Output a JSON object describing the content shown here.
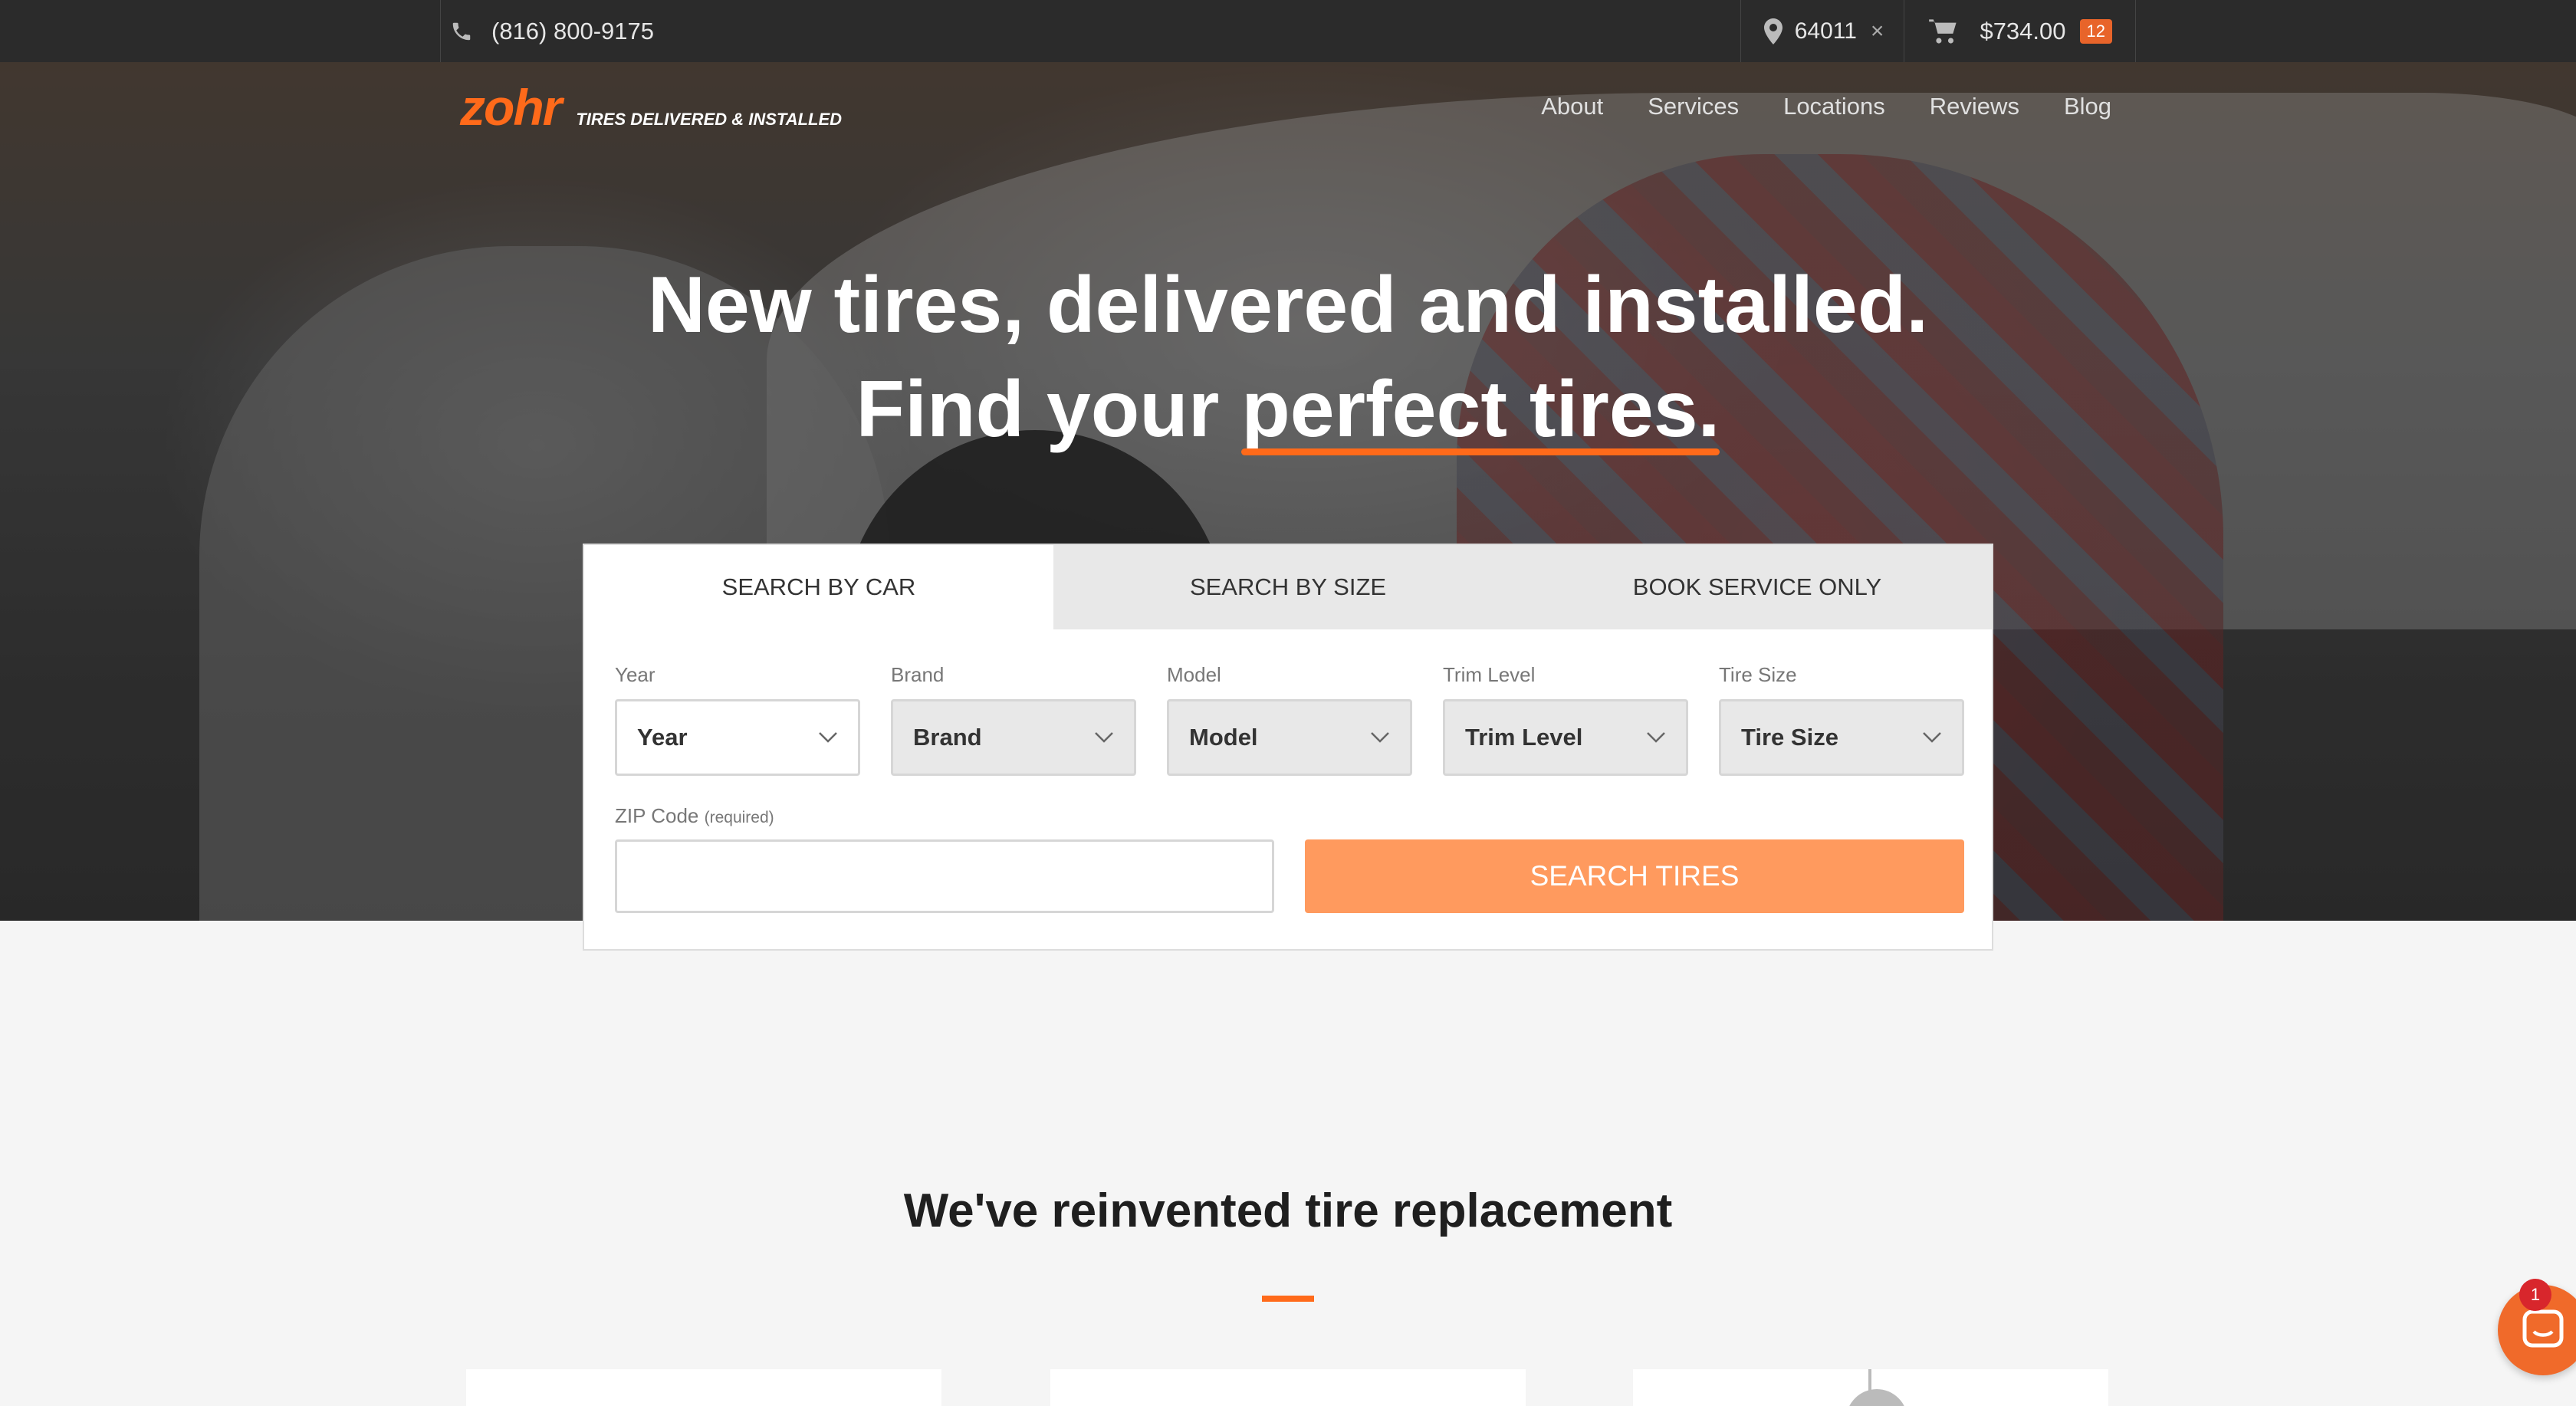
{
  "topbar": {
    "phone": "(816) 800-9175",
    "zip": "64011",
    "zip_clear": "×",
    "cart_total": "$734.00",
    "cart_count": "12"
  },
  "header": {
    "logo": "zohr",
    "tagline": "TIRES DELIVERED & INSTALLED",
    "nav": [
      "About",
      "Services",
      "Locations",
      "Reviews",
      "Blog"
    ]
  },
  "hero": {
    "line1": "New tires, delivered and installed.",
    "line2_prefix": "Find your ",
    "line2_highlight": "perfect tires."
  },
  "search": {
    "tabs": [
      "SEARCH BY CAR",
      "SEARCH BY SIZE",
      "BOOK SERVICE ONLY"
    ],
    "active_tab": "SEARCH BY CAR",
    "fields": [
      {
        "label": "Year",
        "value": "Year"
      },
      {
        "label": "Brand",
        "value": "Brand"
      },
      {
        "label": "Model",
        "value": "Model"
      },
      {
        "label": "Trim Level",
        "value": "Trim Level"
      },
      {
        "label": "Tire Size",
        "value": "Tire Size"
      }
    ],
    "zip_label": "ZIP Code",
    "zip_required": "(required)",
    "zip_value": "",
    "button": "SEARCH TIRES"
  },
  "section": {
    "title": "We've reinvented tire replacement"
  },
  "chat": {
    "badge": "1"
  },
  "colors": {
    "brand_orange": "#ff6a1a",
    "button_orange": "#ff9a5e",
    "topbar": "#2b2b2b"
  }
}
